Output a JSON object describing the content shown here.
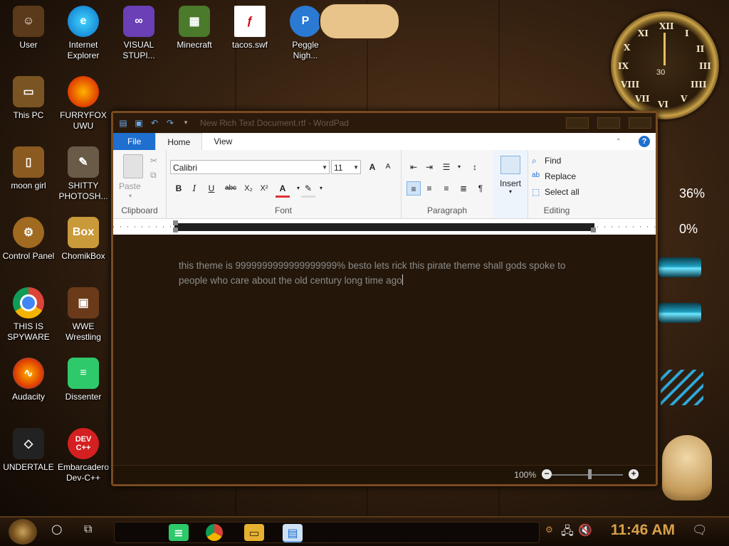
{
  "desktop": {
    "icons": [
      {
        "label": "User"
      },
      {
        "label": "Internet\nExplorer"
      },
      {
        "label": "VISUAL\nSTUPI..."
      },
      {
        "label": "Minecraft"
      },
      {
        "label": "tacos.swf"
      },
      {
        "label": "Peggle\nNigh..."
      },
      {
        "label": "This PC"
      },
      {
        "label": "FURRYFOX\nUWU"
      },
      {
        "label": "moon girl"
      },
      {
        "label": "SHITTY\nPHOTOSH..."
      },
      {
        "label": "Control Panel"
      },
      {
        "label": "ChomikBox"
      },
      {
        "label": "THIS IS\nSPYWARE"
      },
      {
        "label": "WWE\nWrestling"
      },
      {
        "label": "Audacity"
      },
      {
        "label": "Dissenter"
      },
      {
        "label": "UNDERTALE"
      },
      {
        "label": "Embarcadero\nDev-C++"
      }
    ],
    "gauges": {
      "cpu": "36%",
      "ram": "0%"
    },
    "clock": {
      "numerals": [
        "XII",
        "I",
        "II",
        "III",
        "IIII",
        "V",
        "VI",
        "VII",
        "VIII",
        "IX",
        "X",
        "XI"
      ],
      "seconds": "30"
    }
  },
  "wordpad": {
    "title": "New Rich Text Document.rtf - WordPad",
    "tabs": {
      "file": "File",
      "home": "Home",
      "view": "View"
    },
    "clipboard": {
      "paste": "Paste",
      "group": "Clipboard"
    },
    "font": {
      "family": "Calibri",
      "size": "11",
      "group": "Font",
      "bold": "B",
      "italic": "I",
      "underline": "U",
      "strike": "abc",
      "sub": "X₂",
      "sup": "X²",
      "grow": "A",
      "shrink": "A"
    },
    "paragraph": {
      "group": "Paragraph"
    },
    "insert": {
      "label": "Insert"
    },
    "editing": {
      "find": "Find",
      "replace": "Replace",
      "select_all": "Select all",
      "group": "Editing"
    },
    "document": {
      "text": "this theme is 9999999999999999999% besto lets rick this pirate theme shall gods spoke to people who care about the old century long time ago"
    },
    "status": {
      "zoom": "100%"
    }
  },
  "taskbar": {
    "time": "11:46 AM"
  }
}
